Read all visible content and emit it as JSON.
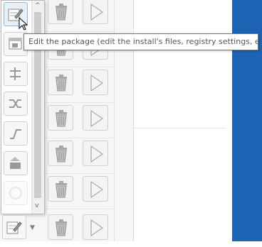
{
  "tooltip": {
    "text": "Edit the package (edit the install's files, registry settings, etc)"
  },
  "scrollbar": {
    "up_arrow": "^",
    "down_arrow": "v"
  },
  "dropdown": {
    "icons": [
      "pencil-notepad-icon",
      "window-package-icon",
      "tree-structure-icon",
      "shuffle-icon",
      "route-icon",
      "package-install-icon",
      "disabled-icon"
    ]
  },
  "colors": {
    "accent_blue": "#1e64b4",
    "tooltip_border": "#767676"
  }
}
